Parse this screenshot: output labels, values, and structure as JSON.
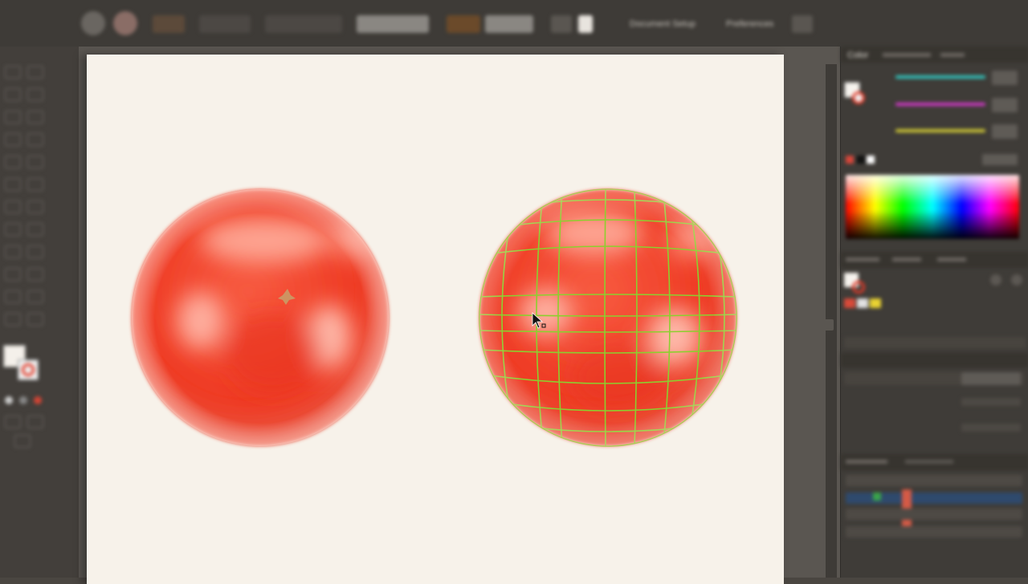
{
  "control_bar": {
    "tools": [
      "selection-tool-button",
      "transform-tool-button"
    ],
    "document_setup_label": "Document Setup",
    "preferences_label": "Preferences"
  },
  "artwork": {
    "tomato_color": "#f1442c",
    "mesh_color": "#8ccf2e"
  },
  "panels": {
    "color_tab": "Color",
    "accent_cyan": "#32c8c0",
    "accent_magenta": "#d238c8",
    "accent_yellow": "#d4cc34"
  }
}
